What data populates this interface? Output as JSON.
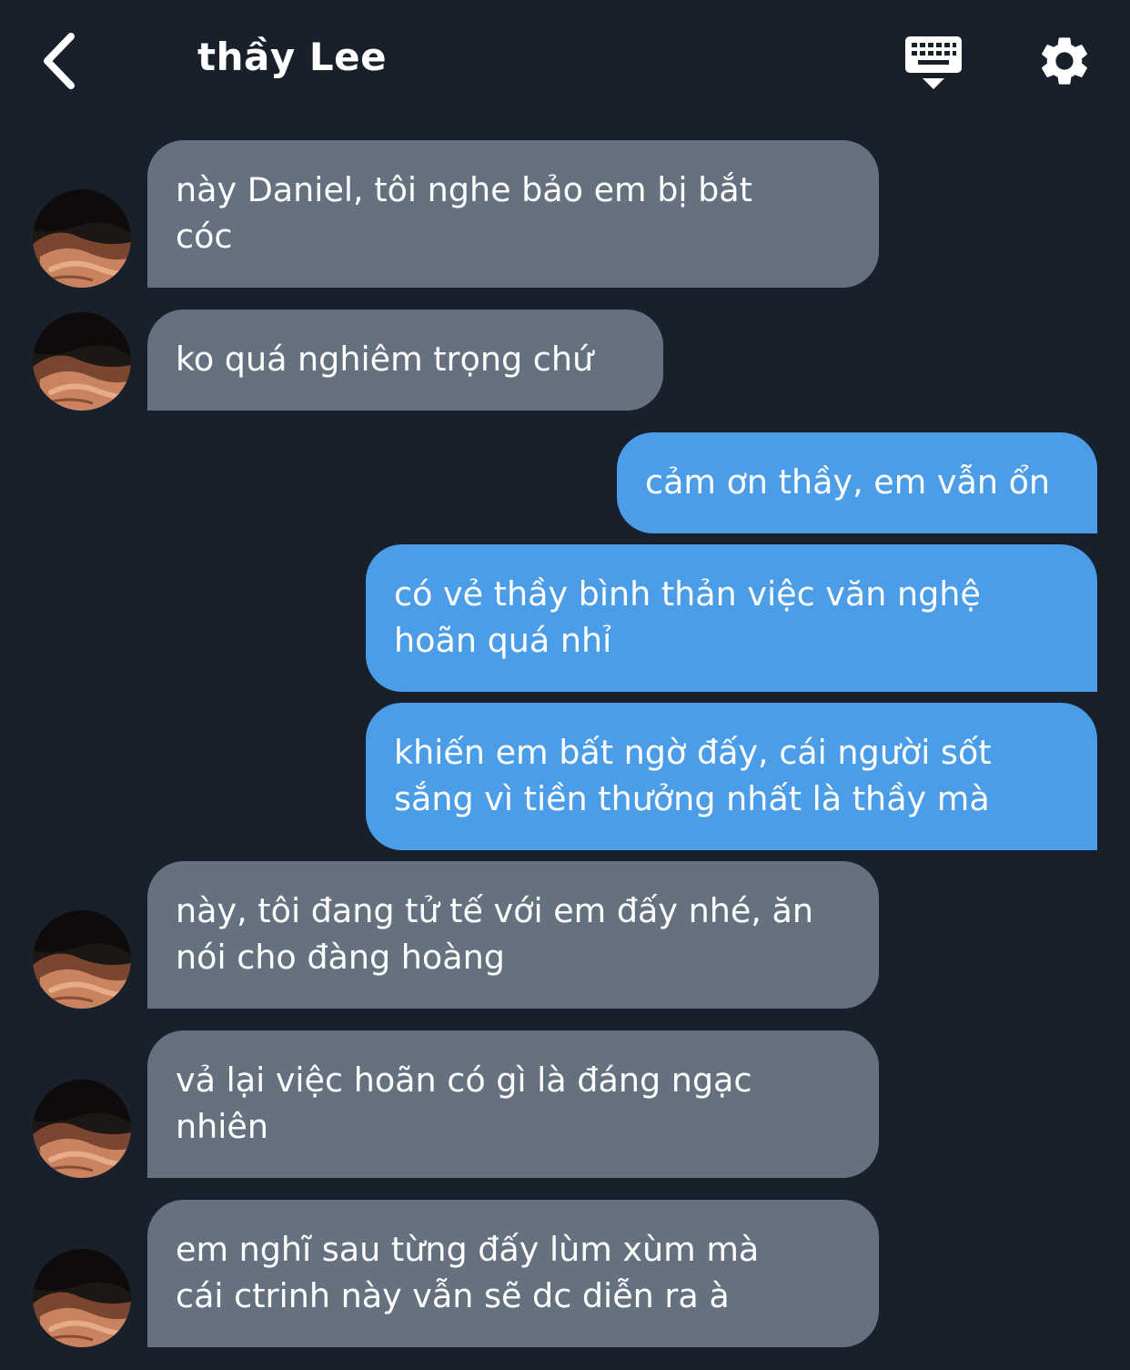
{
  "header": {
    "title": "thầy Lee"
  },
  "messages": [
    {
      "sender": "thầy Lee",
      "direction": "incoming",
      "text_lines": [
        "này Daniel, tôi nghe bảo em bị bắt",
        "cóc"
      ]
    },
    {
      "sender": "thầy Lee",
      "direction": "incoming",
      "text_lines": [
        "ko quá nghiêm trọng chứ"
      ]
    },
    {
      "sender": "me",
      "direction": "outgoing",
      "text_lines": [
        "cảm ơn thầy, em vẫn ổn"
      ]
    },
    {
      "sender": "me",
      "direction": "outgoing",
      "text_lines": [
        "có vẻ thầy bình thản việc văn nghệ",
        "hoãn quá nhỉ"
      ]
    },
    {
      "sender": "me",
      "direction": "outgoing",
      "text_lines": [
        "khiến em bất ngờ đấy, cái người sốt",
        "sắng vì tiền thưởng nhất là thầy mà"
      ]
    },
    {
      "sender": "thầy Lee",
      "direction": "incoming",
      "text_lines": [
        "này, tôi đang tử tế với em đấy nhé, ăn",
        "nói cho đàng hoàng"
      ]
    },
    {
      "sender": "thầy Lee",
      "direction": "incoming",
      "text_lines": [
        "vả lại việc hoãn có gì là đáng ngạc",
        "nhiên"
      ]
    },
    {
      "sender": "thầy Lee",
      "direction": "incoming",
      "text_lines": [
        "em nghĩ sau từng đấy lùm xùm mà",
        "cái ctrinh này vẫn sẽ dc diễn ra à"
      ]
    }
  ],
  "icons": {
    "back": "chevron-left-icon",
    "keyboard": "keyboard-icon",
    "settings": "gear-icon"
  },
  "colors": {
    "background": "#18202b",
    "incoming_bubble": "#65717f",
    "outgoing_bubble": "#4b9de8",
    "text": "#ffffff"
  }
}
